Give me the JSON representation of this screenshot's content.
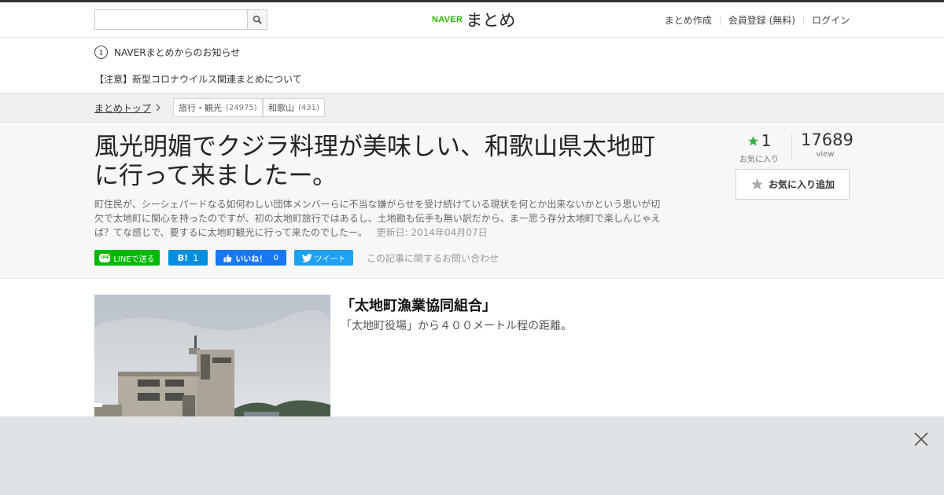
{
  "header": {
    "search_placeholder": "",
    "logo_naver": "NAVER",
    "logo_matome": "まとめ",
    "nav": [
      "まとめ作成",
      "会員登録 (無料)",
      "ログイン"
    ]
  },
  "notice": {
    "title": "NAVERまとめからのお知らせ",
    "link": "【注意】新型コロナウイルス関連まとめについて"
  },
  "breadcrumb": {
    "home": "まとめトップ",
    "tags": [
      {
        "label": "旅行・観光",
        "count": "(24975)"
      },
      {
        "label": "和歌山",
        "count": "(431)"
      }
    ]
  },
  "article": {
    "title": "風光明媚でクジラ料理が美味しい、和歌山県太地町に行って来ましたー。",
    "description": "町住民が、シーシェパードなる如何わしい団体メンバーらに不当な嫌がらせを受け続けている現状を何とか出来ないかという思いが切欠で太地町に関心を持ったのですが、初の太地町旅行ではあるし、土地勘も伝手も無い訳だから、まー思う存分太地町で楽しんじゃえば？てな感じで、要するに太地町観光に行って来たのでしたー。",
    "updated": "更新日: 2014年04月07日",
    "favorites": "1",
    "favorites_label": "お気に入り",
    "views": "17689",
    "views_label": "view",
    "fav_button": "お気に入り追加"
  },
  "share": {
    "line_badge": "LINE",
    "line": "LINEで送る",
    "hatena_mark": "B!",
    "hatena_count": "1",
    "facebook": "いいね！",
    "facebook_count": "0",
    "twitter": "ツイート",
    "inquiry": "この記事に関するお問い合わせ"
  },
  "item": {
    "title": "「太地町漁業協同組合」",
    "description": "「太地町役場」から４００メートル程の距離。"
  },
  "colors": {
    "naver_green": "#2db400",
    "line": "#00b900",
    "hatena": "#008fde",
    "facebook": "#1877f2",
    "twitter": "#1da1f2",
    "star": "#3cb043"
  }
}
